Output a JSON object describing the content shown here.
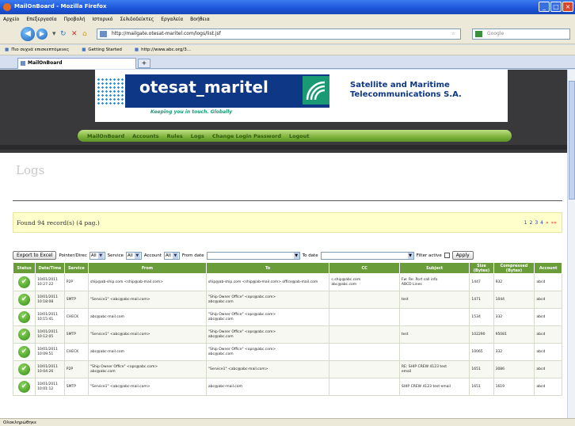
{
  "window": {
    "title": "MailOnBoard - Mozilla Firefox",
    "controls": [
      "_",
      "□",
      "×"
    ]
  },
  "menu": [
    "Αρχείο",
    "Επεξεργασία",
    "Προβολή",
    "Ιστορικό",
    "Σελιδοδείκτες",
    "Εργαλεία",
    "Βοήθεια"
  ],
  "nav": {
    "url": "http://mailgate.otesat-maritel.com/logs/list.jsf",
    "search_placeholder": "Google"
  },
  "bookmarks": [
    "Πιο συχνά επισκεπτόμενες",
    "Getting Started",
    "http://www.abc.org/3..."
  ],
  "tab": {
    "label": "MailOnBoard",
    "new_tab": "+"
  },
  "header": {
    "logo": "otesat_maritel",
    "tagline": "Keeping you in touch. Globally",
    "company_line1": "Satellite and Maritime",
    "company_line2": "Telecommunications S.A."
  },
  "site_nav": [
    "MailOnBoard",
    "Accounts",
    "Rules",
    "Logs",
    "Change Login Password",
    "Logout"
  ],
  "page": {
    "title": "Logs"
  },
  "results": {
    "found": "Found 94 record(s) (4 pag.)",
    "pages": [
      "1",
      "2",
      "3",
      "4"
    ],
    "next": "»",
    "last": "»»"
  },
  "filters": {
    "export_label": "Export to Excel",
    "pointer_label": "Pointer/Direc",
    "pointer_value": "All",
    "service_label": "Service",
    "service_value": "All",
    "account_label": "Account",
    "account_value": "All",
    "from_label": "From date",
    "to_label": "To date",
    "filter_active_label": "Filter active",
    "apply_label": "Apply"
  },
  "table": {
    "headers": [
      "Status",
      "Date/Time",
      "Service",
      "From",
      "To",
      "CC",
      "Subject",
      "Size (Bytes)",
      "Compressed (Bytes)",
      "Account"
    ],
    "rows": [
      [
        "",
        "10/01/2011\n10:27:22",
        "P2P",
        "ship@ab-ship.com <ship@ab-mail.com>",
        "ship@ab-ship.com <ship@ab-mail.com> office@ab-mail.com",
        "c.ship@abc.com\nabc@abc.com",
        "Fw: Re: Port call info\nABCD Lines",
        "1447",
        "932",
        "abcd"
      ],
      [
        "",
        "10/01/2011\n10:18:08",
        "SMTP",
        "\"Service1\" <abc@abc-mail.com>",
        "\"Ship Owner Office\" <ops@abc.com>\nabc@abc.com",
        "",
        "test",
        "1471",
        "1044",
        "abcd"
      ],
      [
        "",
        "10/01/2011\n10:15:41",
        "CHECK",
        "abc@abc-mail.com",
        "\"Ship Owner Office\" <ops@abc.com>\nabc@abc.com",
        "",
        "",
        "1534",
        "332",
        "abcd"
      ],
      [
        "",
        "10/01/2011\n10:12:05",
        "SMTP",
        "\"Service1\" <abc@abc-mail.com>",
        "\"Ship Owner Office\" <ops@abc.com>\nabc@abc.com",
        "",
        "test",
        "102290",
        "95081",
        "abcd"
      ],
      [
        "",
        "10/01/2011\n10:09:51",
        "CHECK",
        "abc@abc-mail.com",
        "\"Ship Owner Office\" <ops@abc.com>\nabc@abc.com",
        "",
        "",
        "10065",
        "332",
        "abcd"
      ],
      [
        "",
        "10/01/2011\n10:04:26",
        "P2P",
        "\"Ship Owner Office\" <ops@abc.com>\nabc@abc.com",
        "\"Service1\" <abc@abc-mail.com>",
        "",
        "RE: SHIP CREW 4123 test\nemail",
        "1651",
        "3086",
        "abcd"
      ],
      [
        "",
        "10/01/2011\n10:01:12",
        "SMTP",
        "\"Service1\" <abc@abc-mail.com>",
        "abc@abc-mail.com",
        "",
        "SHIP CREW 4123 test email",
        "1651",
        "1619",
        "abcd"
      ]
    ]
  },
  "status": {
    "text": "Ολοκληρώθηκε"
  }
}
